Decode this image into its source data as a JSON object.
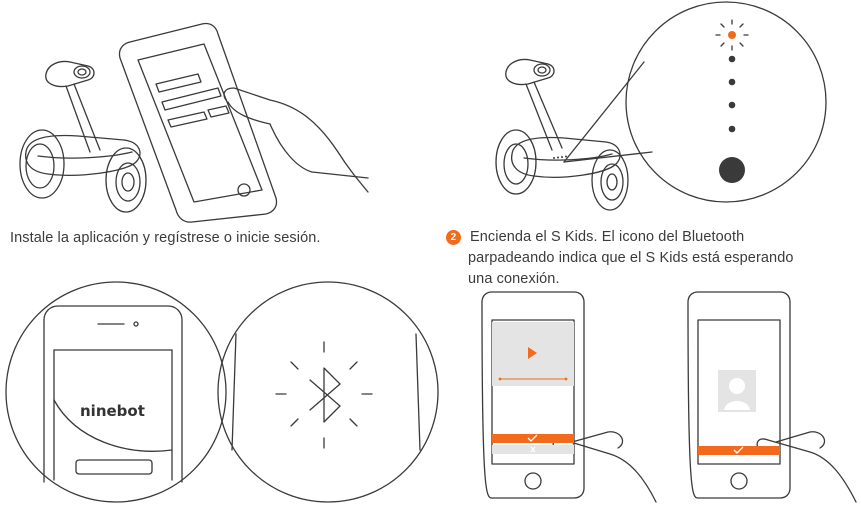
{
  "step1": {
    "caption": "Instale la aplicación y regístrese o inicie sesión."
  },
  "step2": {
    "number": "2",
    "caption_line1": "Encienda el S Kids. El icono del Bluetooth",
    "caption_line2": "parpadeando indica que el S Kids está esperando",
    "caption_line3": "una conexión."
  },
  "phone_screen": {
    "brand": "ninebot"
  },
  "colors": {
    "accent": "#f26b1d",
    "line": "#3a3a3a",
    "screen_gray": "#e4e4e4"
  }
}
